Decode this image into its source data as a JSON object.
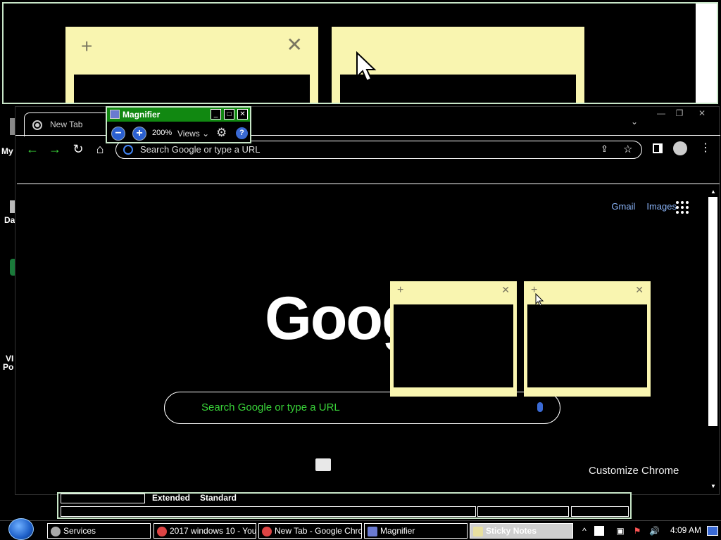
{
  "desktop": {
    "icons": [
      {
        "label": "My"
      },
      {
        "label": "Da"
      },
      {
        "label": "VI"
      },
      {
        "label": "Po"
      }
    ]
  },
  "magnified_view": {
    "note_plus": "+",
    "note_close": "✕"
  },
  "chrome": {
    "tab_title": "New Tab",
    "window_controls": {
      "minimize": "—",
      "maximize": "❐",
      "close": "✕"
    },
    "omnibox_placeholder": "Search Google or type a URL",
    "links": {
      "gmail": "Gmail",
      "images": "Images"
    },
    "logo_text": "Goog",
    "search_placeholder": "Search Google or type a URL",
    "customize": "Customize Chrome"
  },
  "sticky_notes": [
    {
      "plus": "+",
      "close": "✕"
    },
    {
      "plus": "+",
      "close": "✕"
    }
  ],
  "magnifier": {
    "title": "Magnifier",
    "zoom_out": "−",
    "zoom_in": "+",
    "zoom_level": "200%",
    "views_label": "Views",
    "controls": {
      "minimize": "_",
      "maximize": "□",
      "close": "✕"
    }
  },
  "background_window": {
    "tabs": [
      "Extended",
      "Standard"
    ]
  },
  "taskbar": {
    "items": [
      {
        "label": "Services"
      },
      {
        "label": "2017 windows 10 - You..."
      },
      {
        "label": "New Tab - Google Chro..."
      },
      {
        "label": "Magnifier"
      },
      {
        "label": "Sticky Notes"
      }
    ],
    "clock": "4:09 AM"
  }
}
